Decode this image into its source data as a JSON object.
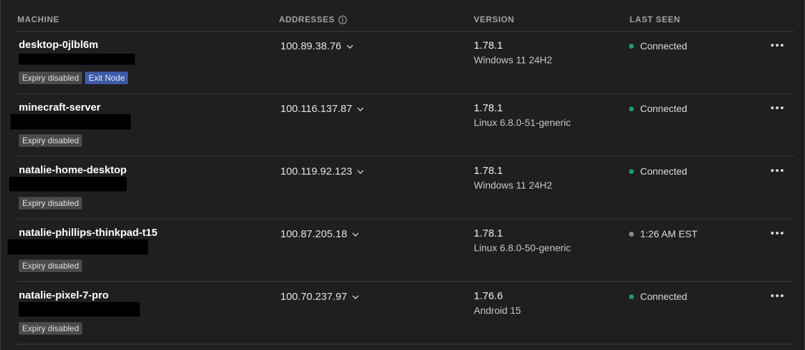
{
  "header": {
    "machine": "MACHINE",
    "addresses": "ADDRESSES",
    "version": "VERSION",
    "last_seen": "LAST SEEN"
  },
  "rows": [
    {
      "name": "desktop-0jlbl6m",
      "badges": [
        "Expiry disabled",
        "Exit Node"
      ],
      "address": "100.89.38.76",
      "version": "1.78.1",
      "os": "Windows 11 24H2",
      "last_seen": "Connected",
      "online": true
    },
    {
      "name": "minecraft-server",
      "badges": [
        "Expiry disabled"
      ],
      "address": "100.116.137.87",
      "version": "1.78.1",
      "os": "Linux 6.8.0-51-generic",
      "last_seen": "Connected",
      "online": true
    },
    {
      "name": "natalie-home-desktop",
      "badges": [
        "Expiry disabled"
      ],
      "address": "100.119.92.123",
      "version": "1.78.1",
      "os": "Windows 11 24H2",
      "last_seen": "Connected",
      "online": true
    },
    {
      "name": "natalie-phillips-thinkpad-t15",
      "badges": [
        "Expiry disabled"
      ],
      "address": "100.87.205.18",
      "version": "1.78.1",
      "os": "Linux 6.8.0-50-generic",
      "last_seen": "1:26 AM EST",
      "online": false
    },
    {
      "name": "natalie-pixel-7-pro",
      "badges": [
        "Expiry disabled"
      ],
      "address": "100.70.237.97",
      "version": "1.76.6",
      "os": "Android 15",
      "last_seen": "Connected",
      "online": true
    }
  ],
  "colors": {
    "online": "#1f9d63",
    "offline": "#8a8a8a",
    "exit_node_badge": "#3d5aa8"
  },
  "icons": {
    "addresses_info": "info-icon",
    "address_toggle": "chevron-down-icon",
    "row_menu": "more-horizontal-icon"
  }
}
